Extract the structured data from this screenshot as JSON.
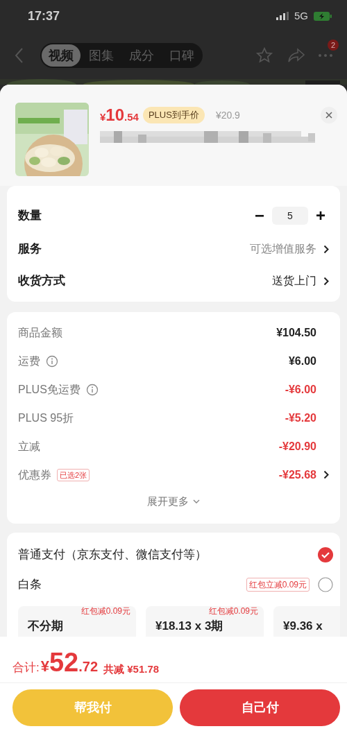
{
  "status_bar": {
    "time": "17:37",
    "network": "5G"
  },
  "nav": {
    "tabs": [
      {
        "label": "视频",
        "selected": true
      },
      {
        "label": "图集",
        "selected": false
      },
      {
        "label": "成分",
        "selected": false
      },
      {
        "label": "口碑",
        "selected": false
      }
    ],
    "badge": "2"
  },
  "product": {
    "price_symbol": "¥",
    "price_int": "10",
    "price_dec": ".54",
    "plus_tag": "PLUS到手价",
    "original_price": "¥20.9"
  },
  "options": [
    {
      "kind": "stepper",
      "label": "数量",
      "minus": "−",
      "value": "5",
      "plus": "+"
    },
    {
      "kind": "link",
      "label": "服务",
      "value": "可选增值服务",
      "muted": true
    },
    {
      "kind": "link",
      "label": "收货方式",
      "value": "送货上门",
      "muted": false
    }
  ],
  "summary": {
    "rows": [
      {
        "label": "商品金额",
        "value": "¥104.50",
        "discount": false,
        "info": false,
        "chevron": false
      },
      {
        "label": "运费",
        "value": "¥6.00",
        "discount": false,
        "info": true,
        "chevron": false
      },
      {
        "label": "PLUS免运费",
        "value": "-¥6.00",
        "discount": true,
        "info": true,
        "chevron": false
      },
      {
        "label": "PLUS 95折",
        "value": "-¥5.20",
        "discount": true,
        "info": false,
        "chevron": false
      },
      {
        "label": "立减",
        "value": "-¥20.90",
        "discount": true,
        "info": false,
        "chevron": false
      },
      {
        "label": "优惠券",
        "tag": "已选2张",
        "value": "-¥25.68",
        "discount": true,
        "info": false,
        "chevron": true
      }
    ],
    "expand": "展开更多"
  },
  "payment": {
    "options": [
      {
        "label": "普通支付（京东支付、微信支付等）",
        "selected": true
      },
      {
        "label": "白条",
        "tag": "红包立减0.09元",
        "selected": false
      }
    ],
    "installments": [
      {
        "promo": "红包减0.09元",
        "label": "不分期"
      },
      {
        "promo": "红包减0.09元",
        "label": "¥18.13 x 3期"
      },
      {
        "label": "¥9.36 x"
      }
    ]
  },
  "footer": {
    "total_label": "合计:",
    "total_symbol": "¥",
    "total_int": "52",
    "total_dec": ".72",
    "saved": "共减 ¥51.78",
    "buttons": [
      {
        "label": "帮我付",
        "kind": "secondary"
      },
      {
        "label": "自己付",
        "kind": "primary"
      }
    ]
  }
}
